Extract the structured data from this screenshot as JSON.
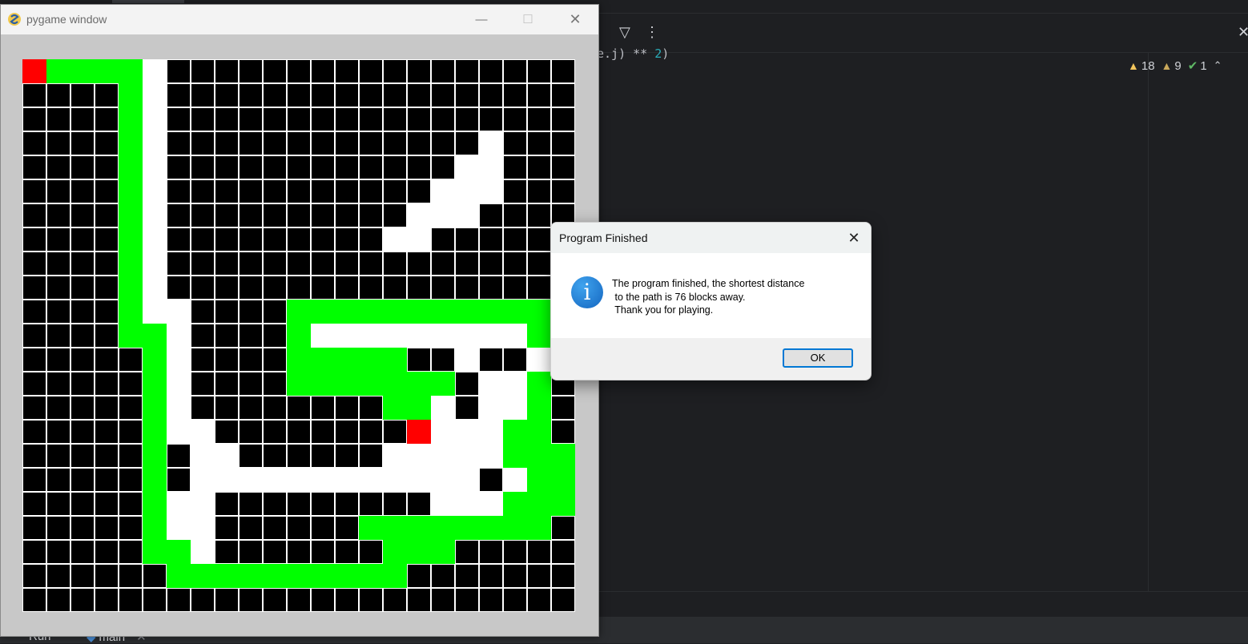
{
  "pygame_window": {
    "title": "pygame window",
    "logo_icon": "pygame-snake-icon",
    "controls": {
      "minimize": "minimize-icon",
      "maximize": "maximize-icon",
      "close": "close-icon"
    },
    "grid": {
      "rows": 23,
      "cols": 23,
      "legend": {
        "#": "wall (black)",
        ".": "open (white)",
        "G": "path (green)",
        "R": "endpoint (red)"
      },
      "colors": {
        "#": "#000000",
        ".": "#ffffff",
        "G": "#00ff00",
        "R": "#ff0000"
      },
      "cells": [
        "RGGGG.#################",
        "####G.#################",
        "####G.#################",
        "####G.#############.###",
        "####G.############..###",
        "####G.###########...###",
        "####G.##########...####",
        "####G.#########..######",
        "####G.#################",
        "####G.#################",
        "####G..####GGGGGGGGGGGG",
        "####GG.####G.........GG",
        "#####G.####GGGGG##.##.G",
        "#####G.####GGGGGGG#..G",
        "#####G.########GG.#..G",
        "#####G..########R...GG",
        "#####G#..######.....GGG",
        "#####G#............#.GG",
        "#####G..#########...GGG",
        "#####G..######GGGGGGGG#",
        "#####GG.#######GGG#####",
        "######GGGGGGGGGG#######",
        "#######################"
      ]
    }
  },
  "dialog": {
    "title": "Program Finished",
    "close_icon": "close-icon",
    "info_icon": "info-icon",
    "info_glyph": "i",
    "message": "The program finished, the shortest distance\n to the path is 76 blocks away.\n Thank you for playing.",
    "ok_label": "OK"
  },
  "ide": {
    "code_fragment_prefix": "e.j) ** ",
    "code_fragment_number": "2",
    "code_fragment_suffix": ")",
    "inspections": {
      "warnings": "18",
      "weak_warnings": "9",
      "ok": "1"
    },
    "bottom_tabs": {
      "run_label": "Run",
      "main_label": "main"
    }
  }
}
